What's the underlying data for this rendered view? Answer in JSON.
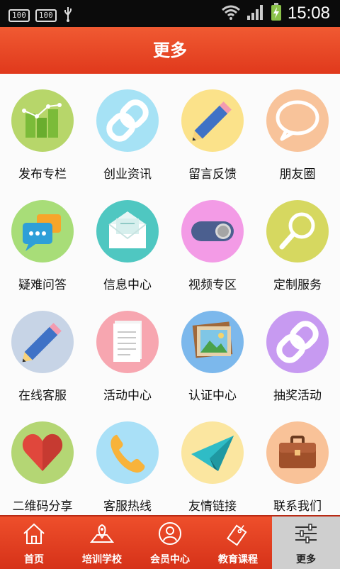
{
  "status_bar": {
    "badge_left": "100",
    "badge_right": "100",
    "time": "15:08"
  },
  "header": {
    "title": "更多"
  },
  "grid_items": [
    {
      "label": "发布专栏",
      "icon": "bar-chart-icon",
      "color": "#b7d66a"
    },
    {
      "label": "创业资讯",
      "icon": "link-icon",
      "color": "#a6e2f5"
    },
    {
      "label": "留言反馈",
      "icon": "pencil-icon",
      "color": "#fbe28a"
    },
    {
      "label": "朋友圈",
      "icon": "speech-bubble-icon",
      "color": "#f8c39a"
    },
    {
      "label": "疑难问答",
      "icon": "chat-icon",
      "color": "#a8dd78"
    },
    {
      "label": "信息中心",
      "icon": "envelope-icon",
      "color": "#4fc7c1"
    },
    {
      "label": "视频专区",
      "icon": "toggle-icon",
      "color": "#f39be6"
    },
    {
      "label": "定制服务",
      "icon": "magnifier-icon",
      "color": "#d6d860"
    },
    {
      "label": "在线客服",
      "icon": "pencil-icon",
      "color": "#c7d4e6"
    },
    {
      "label": "活动中心",
      "icon": "document-icon",
      "color": "#f7a6b0"
    },
    {
      "label": "认证中心",
      "icon": "picture-icon",
      "color": "#7cb8ec"
    },
    {
      "label": "抽奖活动",
      "icon": "link-icon",
      "color": "#c79af1"
    },
    {
      "label": "二维码分享",
      "icon": "heart-icon",
      "color": "#b4d674"
    },
    {
      "label": "客服热线",
      "icon": "phone-icon",
      "color": "#a9e0f7"
    },
    {
      "label": "友情链接",
      "icon": "paper-plane-icon",
      "color": "#fbe6a0"
    },
    {
      "label": "联系我们",
      "icon": "briefcase-icon",
      "color": "#f9c298"
    }
  ],
  "tabs": [
    {
      "label": "首页",
      "icon": "home-icon"
    },
    {
      "label": "培训学校",
      "icon": "map-icon"
    },
    {
      "label": "会员中心",
      "icon": "user-icon"
    },
    {
      "label": "教育课程",
      "icon": "sale-tag-icon"
    },
    {
      "label": "更多",
      "icon": "sliders-icon",
      "active": true
    }
  ]
}
